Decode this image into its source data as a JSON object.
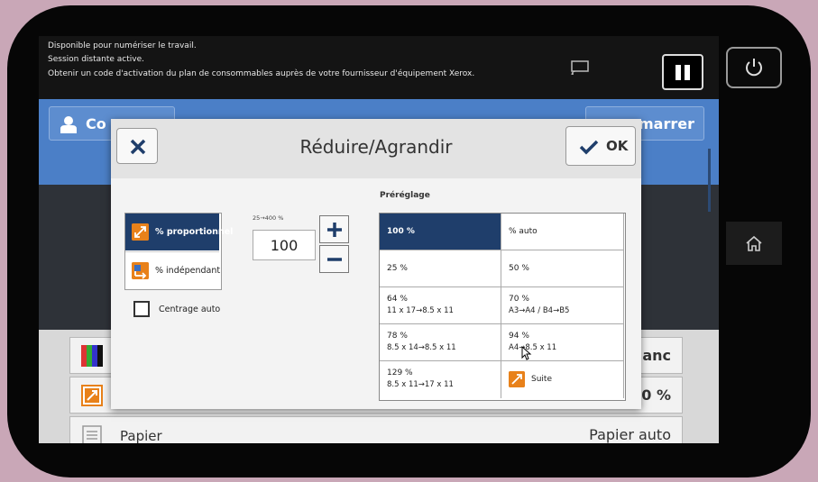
{
  "status": {
    "line1": "Disponible pour numériser le travail.",
    "line2": "Session distante active.",
    "line3": "Obtenir un code d'activation du plan de consommables auprès de votre fournisseur d'équipement Xerox."
  },
  "background": {
    "connexion_label": "Co",
    "demarrer_label": "marrer",
    "row1_value": "lanc",
    "row2_value": "0 %",
    "row3_label": "Papier",
    "row3_value": "Papier auto"
  },
  "dialog": {
    "title": "Réduire/Agrandir",
    "ok_label": "OK",
    "mode_proportional": "% proportionnel",
    "mode_independent": "% indépendant",
    "range_label": "25→400 %",
    "value": "100",
    "center_label": "Centrage auto",
    "preset_title": "Préréglage",
    "presets": [
      {
        "l1": "100 %",
        "l2": ""
      },
      {
        "l1": "% auto",
        "l2": ""
      },
      {
        "l1": "25 %",
        "l2": ""
      },
      {
        "l1": "50 %",
        "l2": ""
      },
      {
        "l1": "64 %",
        "l2": "11 x 17→8.5 x 11"
      },
      {
        "l1": "70 %",
        "l2": "A3→A4 / B4→B5"
      },
      {
        "l1": "78 %",
        "l2": "8.5 x 14→8.5 x 11"
      },
      {
        "l1": "94 %",
        "l2": "A4→8.5 x 11"
      },
      {
        "l1": "129 %",
        "l2": "8.5 x 11→17 x 11"
      },
      {
        "l1": "Suite",
        "l2": ""
      }
    ]
  },
  "colors": {
    "accent_blue": "#4b7fc7",
    "selected_navy": "#1f3e6b",
    "orange_icon": "#e8811a"
  }
}
